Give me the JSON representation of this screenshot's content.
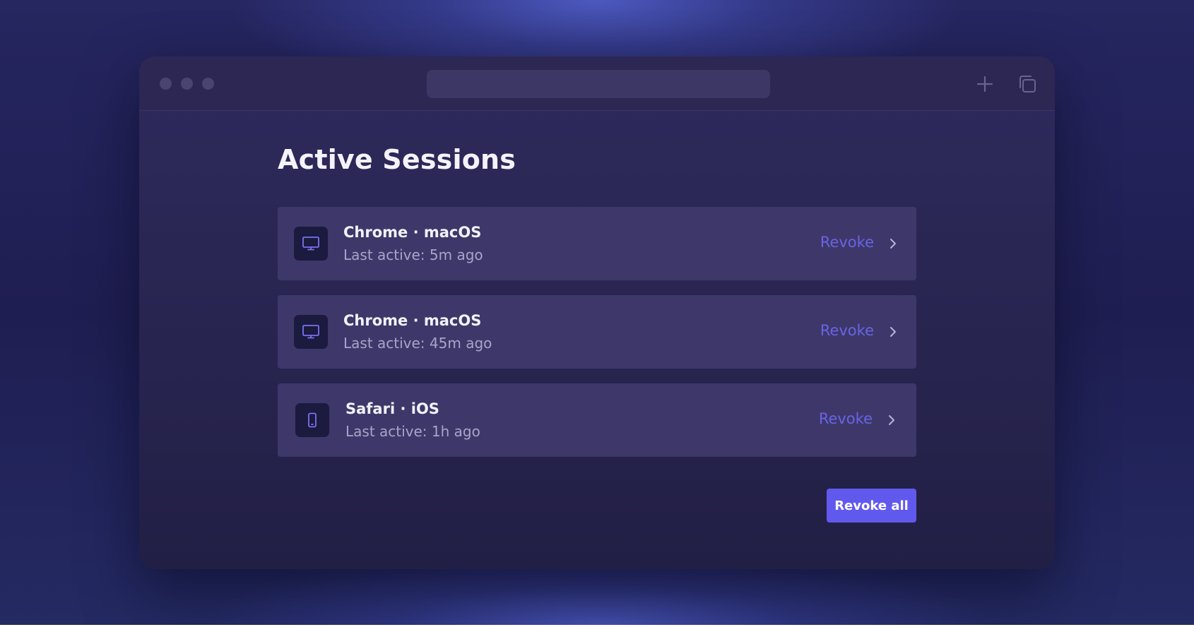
{
  "page": {
    "title": "Active Sessions"
  },
  "sessions": [
    {
      "name": "Chrome · macOS",
      "last_active": "Last active: 5m ago",
      "device_icon": "desktop-icon",
      "action_label": "Revoke"
    },
    {
      "name": "Chrome · macOS",
      "last_active": "Last active: 45m ago",
      "device_icon": "desktop-icon",
      "action_label": "Revoke"
    },
    {
      "name": "Safari · iOS",
      "last_active": "Last active: 1h ago",
      "device_icon": "phone-icon",
      "action_label": "Revoke"
    }
  ],
  "actions": {
    "revoke_all_label": "Revoke all"
  },
  "colors": {
    "accent": "#6159ee",
    "link": "#6b63e6",
    "card": "#3d3869",
    "icon_tile": "#1b1a3f"
  },
  "icons": {
    "titlebar_right": [
      "plus-icon",
      "copy-tabs-icon"
    ],
    "row_chevron": "chevron-right-icon"
  }
}
